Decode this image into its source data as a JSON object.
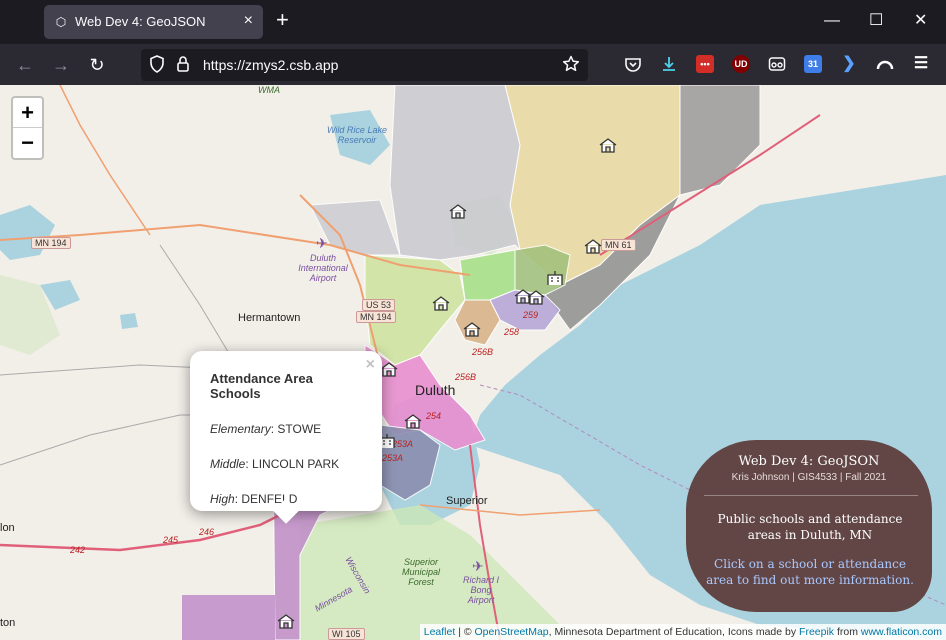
{
  "browser": {
    "tab_title": "Web Dev 4: GeoJSON",
    "tab_close": "×",
    "new_tab": "+",
    "url": "https://zmys2.csb.app",
    "window_controls": {
      "minimize": "—",
      "maximize": "☐",
      "close": "✕"
    },
    "nav": {
      "back": "←",
      "forward": "→",
      "reload": "↻"
    },
    "icons": [
      "shield-icon",
      "lock-icon",
      "star-icon",
      "pocket-icon",
      "download-icon",
      "extension-lastpass-icon",
      "extension-ublock-icon",
      "extension-glasses-icon",
      "calendar-icon",
      "arrow-extension-icon",
      "account-icon",
      "menu-icon"
    ],
    "calendar_day": "31",
    "ublock_label": "UD"
  },
  "map": {
    "zoom_in": "+",
    "zoom_out": "−",
    "labels": {
      "wma": "WMA",
      "reservoir": "Wild Rice Lake Reservoir",
      "airport_duluth": "Duluth International Airport",
      "hermantown": "Hermantown",
      "duluth": "Duluth",
      "superior": "Superior",
      "superior_forest": "Superior Municipal Forest",
      "bong_airport": "Richard I Bong Airport",
      "wisconsin": "Wisconsin",
      "minnesota": "Minnesota",
      "left_edge_a": "lon",
      "left_edge_b": "ton"
    },
    "shields": {
      "mn194_west": "MN 194",
      "mn61": "MN 61",
      "us53": "US 53",
      "mn194_center": "MN 194",
      "wi105": "WI 105"
    },
    "road_numbers": [
      "259",
      "258",
      "256B",
      "256B",
      "254",
      "253A",
      "253A",
      "246",
      "245",
      "242"
    ]
  },
  "popup": {
    "close": "×",
    "title": "Attendance Area Schools",
    "rows": [
      {
        "key": "Elementary",
        "value": ": STOWE"
      },
      {
        "key": "Middle",
        "value": ": LINCOLN PARK"
      },
      {
        "key": "High",
        "value": ": DENFELD"
      }
    ]
  },
  "info": {
    "title": "Web Dev 4: GeoJSON",
    "subtitle": "Kris Johnson | GIS4533 | Fall 2021",
    "description": "Public schools and attendance areas in Duluth, MN",
    "cta": "Click on a school or attendance area to find out more information."
  },
  "attribution": {
    "leaflet": "Leaflet",
    "sep1": " | © ",
    "osm": "OpenStreetMap",
    "mid": ", Minnesota Department of Education, Icons made by ",
    "freepik": "Freepik",
    "from": " from ",
    "flaticon": "www.flaticon.com"
  },
  "colors": {
    "lake": "#aad3df",
    "tan_zone": "#e9d9a0",
    "gray_zone": "#c9c9d0",
    "green_zone": "#cfe3a0",
    "bright_green_zone": "#a8e08a",
    "purple_zone": "#b7a7d8",
    "pink_zone": "#e98fcf",
    "mauve_zone": "#c08cc8",
    "dark_gray_zone": "#9a9a9a",
    "info_box": "#5c3a38",
    "link": "#0078a8"
  }
}
